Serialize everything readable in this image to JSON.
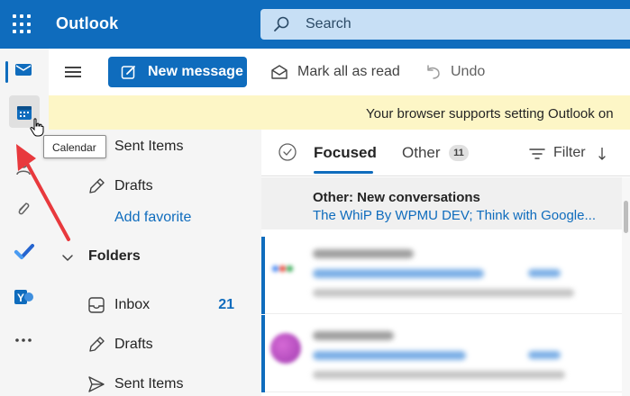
{
  "app": {
    "title": "Outlook"
  },
  "search": {
    "placeholder": "Search"
  },
  "toolbar": {
    "new_message_label": "New message",
    "mark_all_read_label": "Mark all as read",
    "undo_label": "Undo"
  },
  "banner": {
    "text": "Your browser supports setting Outlook on"
  },
  "tooltip": {
    "text": "Calendar"
  },
  "rail": {
    "items": [
      {
        "name": "mail",
        "icon": "mail-icon"
      },
      {
        "name": "calendar",
        "icon": "calendar-icon"
      },
      {
        "name": "people",
        "icon": "people-icon"
      },
      {
        "name": "files",
        "icon": "paperclip-icon"
      },
      {
        "name": "to-do",
        "icon": "todo-check-icon"
      },
      {
        "name": "yammer",
        "icon": "yammer-icon"
      },
      {
        "name": "more-apps",
        "icon": "more-icon"
      }
    ]
  },
  "favorites": {
    "items": [
      {
        "label": "Sent Items",
        "icon": "send-icon"
      },
      {
        "label": "Drafts",
        "icon": "pencil-icon"
      }
    ],
    "add_favorite_label": "Add favorite"
  },
  "folders": {
    "header": "Folders",
    "items": [
      {
        "label": "Inbox",
        "icon": "inbox-icon",
        "count": "21"
      },
      {
        "label": "Drafts",
        "icon": "pencil-icon",
        "count": ""
      },
      {
        "label": "Sent Items",
        "icon": "send-icon",
        "count": ""
      }
    ]
  },
  "message_list": {
    "tabs": [
      {
        "label": "Focused",
        "selected": true
      },
      {
        "label": "Other",
        "badge": "11",
        "selected": false
      }
    ],
    "filter_label": "Filter",
    "other_notice": {
      "title": "Other: New conversations",
      "senders": "The WhiP By WPMU DEV; Think with Google..."
    }
  },
  "colors": {
    "brand": "#0f6cbd",
    "banner": "#fdf6c6",
    "annotation_arrow": "#e8393d"
  }
}
